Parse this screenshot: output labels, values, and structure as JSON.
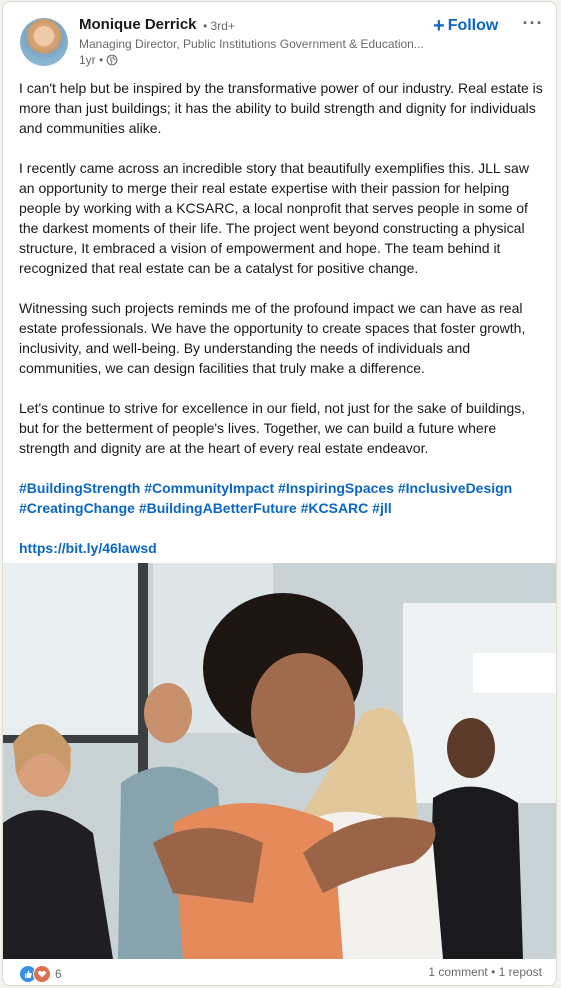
{
  "author": {
    "name": "Monique Derrick",
    "degree": "• 3rd+",
    "headline": "Managing Director, Public Institutions Government & Education...",
    "time": "1yr •"
  },
  "header": {
    "follow_label": "Follow",
    "more_label": "···"
  },
  "post": {
    "paragraphs": [
      "I can't help but be inspired by the transformative power of our industry. Real estate is more than just buildings; it has the ability to build strength and dignity for individuals and communities alike.",
      "I recently came across an incredible story that beautifully exemplifies this. JLL saw an opportunity to merge their real estate expertise with their passion for helping people by working with a KCSARC, a local nonprofit that serves people in some of the darkest moments of their life. The project went beyond constructing a physical structure, It embraced a vision of empowerment and hope. The team behind it recognized that real estate can be a catalyst for positive change.",
      "Witnessing such projects reminds me of the profound impact we can have as real estate professionals. We have the opportunity to create spaces that foster growth, inclusivity, and well-being. By understanding the needs of individuals and communities, we can design facilities that truly make a difference.",
      "Let's continue to strive for excellence in our field, not just for the sake of buildings, but for the betterment of people's lives. Together, we can build a future where strength and dignity are at the heart of every real estate endeavor."
    ],
    "hashtags": [
      "#BuildingStrength",
      "#CommunityImpact",
      "#InspiringSpaces",
      "#InclusiveDesign",
      "#CreatingChange",
      "#BuildingABetterFuture",
      "#KCSARC",
      "#jll"
    ],
    "link": "https://bit.ly/46lawsd"
  },
  "footer": {
    "reaction_count": "6",
    "comments": "1 comment",
    "separator": " • ",
    "reposts": "1 repost"
  },
  "colors": {
    "link": "#0a66c2",
    "like": "#378fe9",
    "love": "#df704d"
  }
}
